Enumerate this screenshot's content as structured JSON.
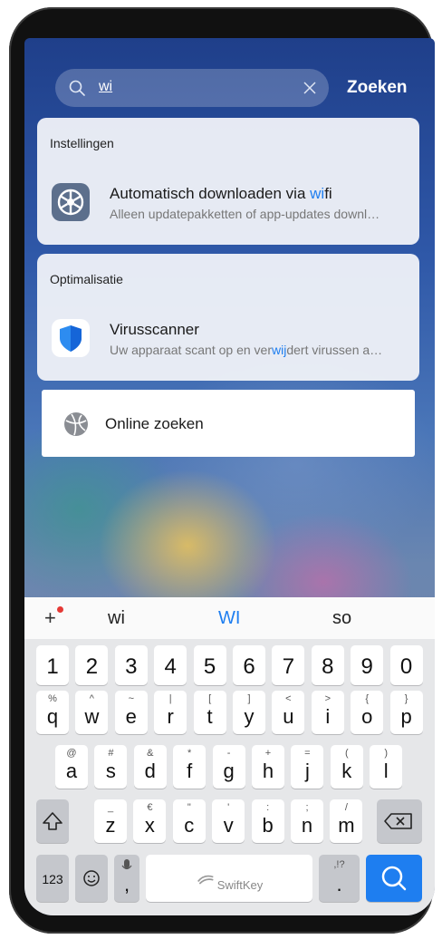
{
  "search": {
    "query": "wi",
    "action_label": "Zoeken"
  },
  "results": {
    "sections": [
      {
        "title": "Instellingen",
        "item": {
          "title_pre": "Automatisch downloaden via ",
          "title_match": "wi",
          "title_post": "fi",
          "subtitle_pre": "Alleen updatepakketten of app-updates downl…",
          "subtitle_match": "",
          "subtitle_post": "",
          "icon": "settings-gear-icon"
        }
      },
      {
        "title": "Optimalisatie",
        "item": {
          "title_pre": "Virusscanner",
          "title_match": "",
          "title_post": "",
          "subtitle_pre": "Uw apparaat scant op en ver",
          "subtitle_match": "wij",
          "subtitle_post": "dert virussen a…",
          "icon": "shield-icon"
        }
      }
    ],
    "online": {
      "label": "Online zoeken",
      "icon": "globe-icon"
    }
  },
  "keyboard": {
    "suggestions": [
      "wi",
      "WI",
      "so"
    ],
    "accent_color": "#1e7ef0",
    "number_row": [
      "1",
      "2",
      "3",
      "4",
      "5",
      "6",
      "7",
      "8",
      "9",
      "0"
    ],
    "row1": [
      [
        "q",
        "%"
      ],
      [
        "w",
        "^"
      ],
      [
        "e",
        "~"
      ],
      [
        "r",
        "|"
      ],
      [
        "t",
        "["
      ],
      [
        "y",
        "]"
      ],
      [
        "u",
        "<"
      ],
      [
        "i",
        ">"
      ],
      [
        "o",
        "{"
      ],
      [
        "p",
        "}"
      ]
    ],
    "row2": [
      [
        "a",
        "@"
      ],
      [
        "s",
        "#"
      ],
      [
        "d",
        "&"
      ],
      [
        "f",
        "*"
      ],
      [
        "g",
        "-"
      ],
      [
        "h",
        "+"
      ],
      [
        "j",
        "="
      ],
      [
        "k",
        "("
      ],
      [
        "l",
        ")"
      ]
    ],
    "row3": [
      [
        "z",
        "_"
      ],
      [
        "x",
        "€"
      ],
      [
        "c",
        "\""
      ],
      [
        "v",
        "'"
      ],
      [
        "b",
        ":"
      ],
      [
        "n",
        ";"
      ],
      [
        "m",
        "/"
      ]
    ],
    "mode_key": "123",
    "comma_key": ",",
    "period_key": ".",
    "period_alt": ",!?",
    "space_label": "SwiftKey"
  }
}
